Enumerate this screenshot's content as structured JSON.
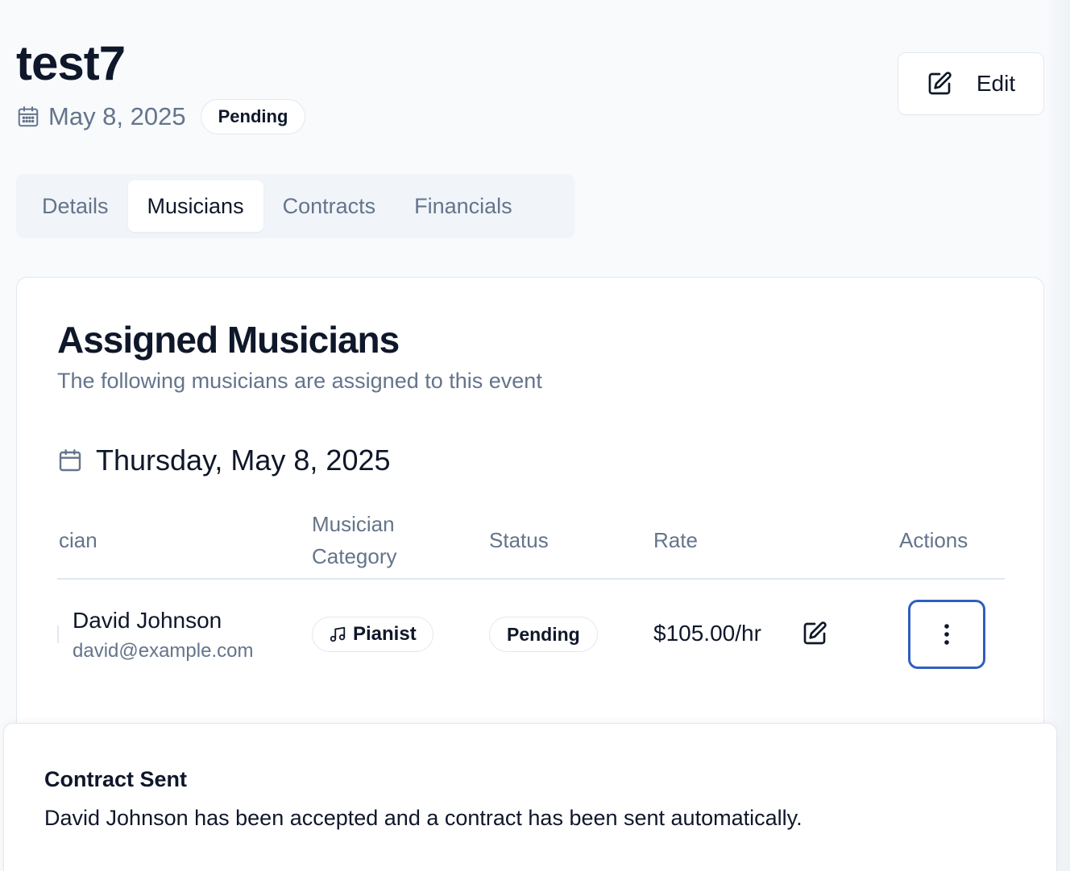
{
  "header": {
    "title": "test7",
    "date": "May 8, 2025",
    "status": "Pending",
    "edit_label": "Edit"
  },
  "tabs": [
    {
      "label": "Details",
      "active": false
    },
    {
      "label": "Musicians",
      "active": true
    },
    {
      "label": "Contracts",
      "active": false
    },
    {
      "label": "Financials",
      "active": false
    }
  ],
  "card": {
    "title": "Assigned Musicians",
    "subtitle": "The following musicians are assigned to this event",
    "date_heading": "Thursday, May 8, 2025"
  },
  "table": {
    "columns": {
      "musician": "cian",
      "category_line1": "Musician",
      "category_line2": "Category",
      "status": "Status",
      "rate": "Rate",
      "actions": "Actions"
    },
    "rows": [
      {
        "name": "David Johnson",
        "email": "david@example.com",
        "category": "Pianist",
        "status": "Pending",
        "rate": "$105.00/hr"
      }
    ]
  },
  "toast": {
    "title": "Contract Sent",
    "message": "David Johnson has been accepted and a contract has been sent automatically."
  },
  "icons": {
    "calendar": "calendar-icon",
    "edit": "pencil-square-icon",
    "music": "music-note-icon",
    "more": "more-vertical-icon"
  },
  "colors": {
    "accent_focus": "#2f5fbf",
    "muted_text": "#64748b",
    "border": "#e2e8f0",
    "background": "#f8fafc"
  }
}
